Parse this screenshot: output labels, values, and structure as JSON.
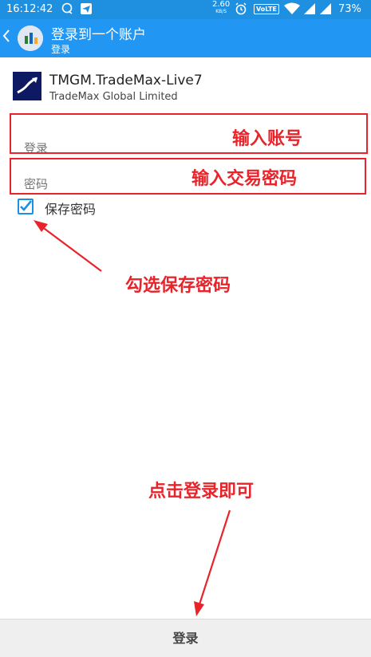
{
  "status_bar": {
    "time": "16:12:42",
    "speed_value": "2.60",
    "speed_unit": "KB/S",
    "volte": "VoLTE",
    "battery": "73%"
  },
  "app_bar": {
    "title": "登录到一个账户",
    "subtitle": "登录"
  },
  "server": {
    "name": "TMGM.TradeMax-Live7",
    "company": "TradeMax Global Limited"
  },
  "form": {
    "login_placeholder": "登录",
    "password_placeholder": "密码",
    "save_password_label": "保存密码",
    "save_password_checked": true
  },
  "annotations": {
    "enter_account": "输入账号",
    "enter_password": "输入交易密码",
    "check_save": "勾选保存密码",
    "click_login": "点击登录即可"
  },
  "footer": {
    "login_button": "登录"
  },
  "colors": {
    "status_bar": "#1f8fe0",
    "app_bar": "#2196f3",
    "annotation_red": "#e8232a"
  }
}
